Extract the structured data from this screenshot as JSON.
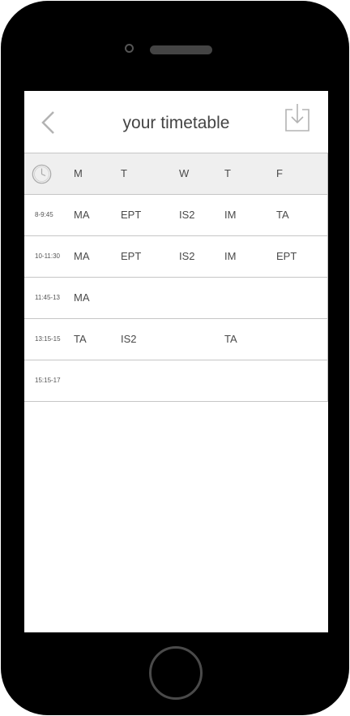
{
  "header": {
    "title": "your timetable"
  },
  "icons": {
    "back": "chevron-left-icon",
    "download": "download-tray-icon",
    "clock": "clock-icon"
  },
  "timetable": {
    "days": [
      "M",
      "T",
      "W",
      "T",
      "F"
    ],
    "rows": [
      {
        "time": "8-9:45",
        "cells": [
          "MA",
          "EPT",
          "IS2",
          "IM",
          "TA"
        ]
      },
      {
        "time": "10-11:30",
        "cells": [
          "MA",
          "EPT",
          "IS2",
          "IM",
          "EPT"
        ]
      },
      {
        "time": "11:45-13",
        "cells": [
          "MA",
          "",
          "",
          "",
          ""
        ]
      },
      {
        "time": "13:15-15",
        "cells": [
          "TA",
          "IS2",
          "",
          "TA",
          ""
        ]
      },
      {
        "time": "15:15-17",
        "cells": [
          "",
          "",
          "",
          "",
          ""
        ]
      }
    ]
  },
  "colors": {
    "text": "#4a4a4a",
    "header_row_bg": "#efefef",
    "divider": "#c6c6c6",
    "icon_gray": "#b3b3b3",
    "device_body": "#000000"
  }
}
